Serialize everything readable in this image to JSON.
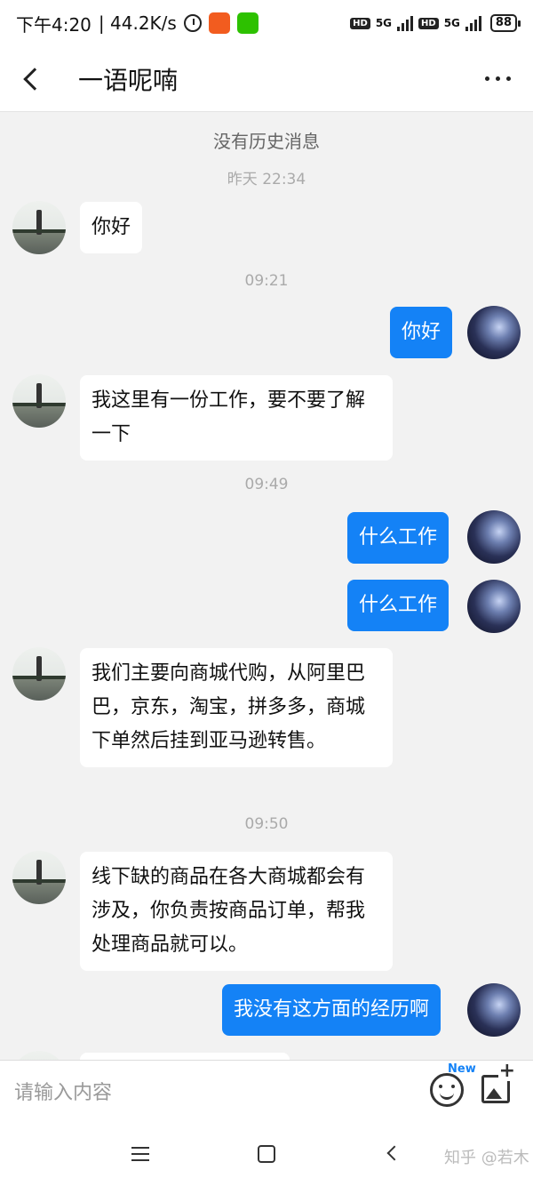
{
  "status_bar": {
    "time": "下午4:20",
    "net_speed": "| 44.2K/s",
    "hd1": "HD",
    "sig1": "5G",
    "hd2": "HD",
    "sig2": "5G",
    "battery": "88",
    "alarm_icon": "alarm-icon",
    "app_icon_color": "#f25c1f",
    "wechat_icon_color": "#2dc100"
  },
  "header": {
    "back_icon": "chevron-left-icon",
    "title": "一语呢喃",
    "more_icon": "more-dots-icon"
  },
  "chat": {
    "no_history": "没有历史消息",
    "messages": [
      {
        "type": "time",
        "text": "昨天 22:34"
      },
      {
        "type": "msg",
        "side": "left",
        "text": "你好"
      },
      {
        "type": "time",
        "text": "09:21"
      },
      {
        "type": "msg",
        "side": "right",
        "text": "你好"
      },
      {
        "type": "msg",
        "side": "left",
        "text": "我这里有一份工作，要不要了解一下"
      },
      {
        "type": "time",
        "text": "09:49"
      },
      {
        "type": "msg",
        "side": "right",
        "text": "什么工作"
      },
      {
        "type": "msg",
        "side": "right",
        "text": "什么工作"
      },
      {
        "type": "msg",
        "side": "left",
        "text": "我们主要向商城代购，从阿里巴巴，京东，淘宝，拼多多，商城下单然后挂到亚马逊转售。"
      },
      {
        "type": "time",
        "text": "09:50"
      },
      {
        "type": "msg",
        "side": "left",
        "text": "线下缺的商品在各大商城都会有涉及，你负责按商品订单，帮我处理商品就可以。"
      },
      {
        "type": "msg",
        "side": "right",
        "text": "我没有这方面的经历啊"
      }
    ],
    "accent_color": "#1482f6"
  },
  "input": {
    "placeholder": "请输入内容",
    "emoji_icon": "emoji-icon",
    "new_badge": "New",
    "image_icon": "image-add-icon"
  },
  "nav": {
    "menu_icon": "menu-icon",
    "home_icon": "home-square-icon",
    "back_icon": "back-triangle-icon",
    "watermark": "知乎 @若木"
  }
}
